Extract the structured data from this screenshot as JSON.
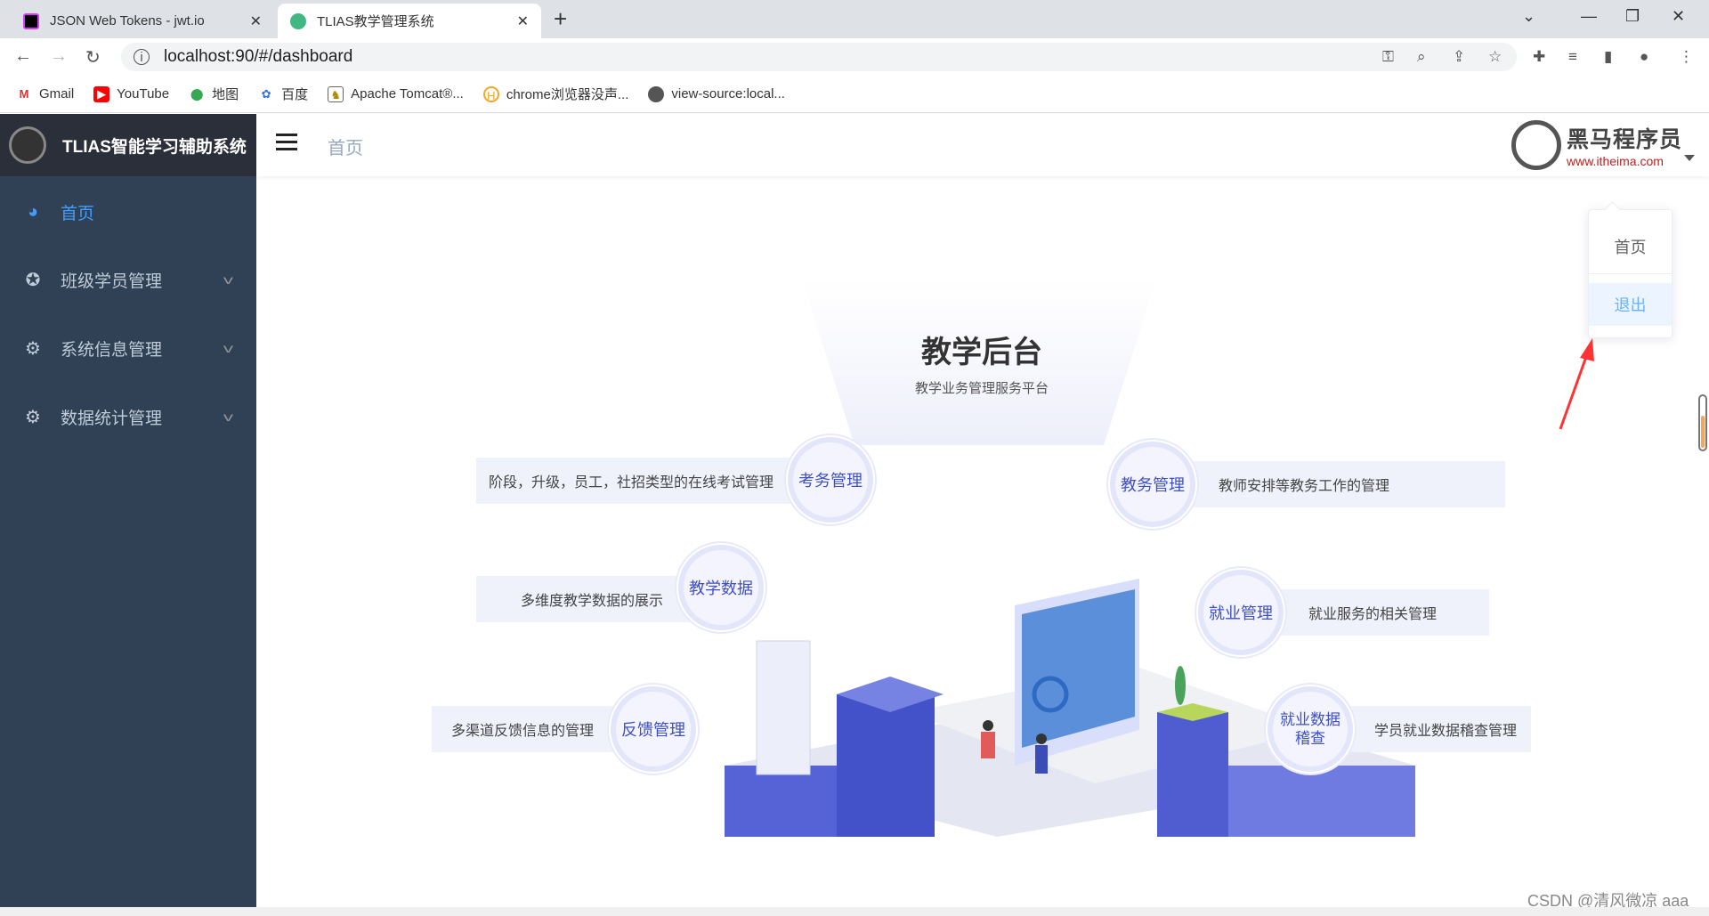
{
  "browser": {
    "tabs": [
      {
        "title": "JSON Web Tokens - jwt.io",
        "active": false
      },
      {
        "title": "TLIAS教学管理系统",
        "active": true
      }
    ],
    "url": "localhost:90/#/dashboard",
    "bookmarks": [
      {
        "label": "Gmail",
        "icon": "gmail-icon"
      },
      {
        "label": "YouTube",
        "icon": "youtube-icon"
      },
      {
        "label": "地图",
        "icon": "maps-icon"
      },
      {
        "label": "百度",
        "icon": "baidu-icon"
      },
      {
        "label": "Apache Tomcat®...",
        "icon": "tomcat-icon"
      },
      {
        "label": "chrome浏览器没声...",
        "icon": "site-icon"
      },
      {
        "label": "view-source:local...",
        "icon": "globe-icon"
      }
    ]
  },
  "app": {
    "title": "TLIAS智能学习辅助系统",
    "breadcrumb": "首页",
    "brand": {
      "name": "黑马程序员",
      "url": "www.itheima.com"
    },
    "sidebar": [
      {
        "label": "首页",
        "icon": "dashboard-icon",
        "active": true
      },
      {
        "label": "班级学员管理",
        "icon": "circle-icon",
        "expandable": true
      },
      {
        "label": "系统信息管理",
        "icon": "gear-icon",
        "expandable": true
      },
      {
        "label": "数据统计管理",
        "icon": "gear-icon",
        "expandable": true
      }
    ],
    "dropdown": [
      {
        "label": "首页"
      },
      {
        "label": "退出",
        "hovered": true
      }
    ],
    "accent": "#409eff"
  },
  "dashboard": {
    "title": "教学后台",
    "subtitle": "教学业务管理服务平台",
    "modules": [
      {
        "name": "考务管理",
        "desc": "阶段，升级，员工，社招类型的在线考试管理"
      },
      {
        "name": "教务管理",
        "desc": "教师安排等教务工作的管理"
      },
      {
        "name": "教学数据",
        "desc": "多维度教学数据的展示"
      },
      {
        "name": "就业管理",
        "desc": "就业服务的相关管理"
      },
      {
        "name": "反馈管理",
        "desc": "多渠道反馈信息的管理"
      },
      {
        "name": "就业数据稽查",
        "desc": "学员就业数据稽查管理"
      }
    ]
  },
  "watermark": "CSDN @清风微凉 aaa"
}
